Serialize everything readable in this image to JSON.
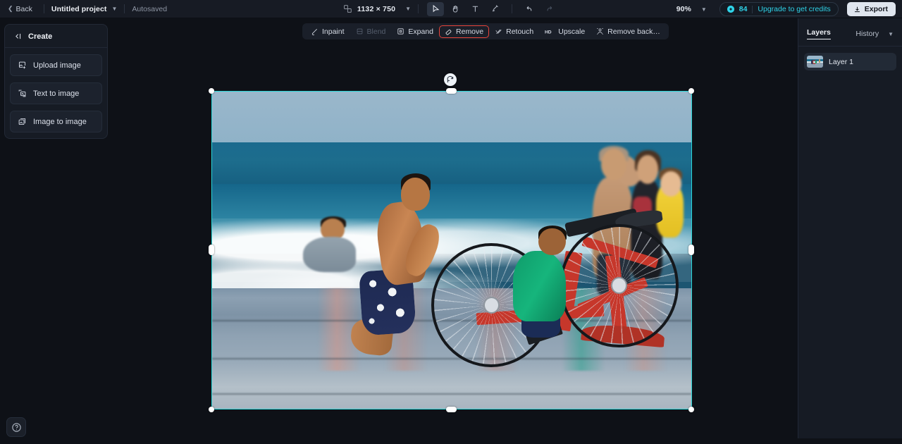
{
  "topbar": {
    "back_label": "Back",
    "project_name": "Untitled project",
    "autosaved_label": "Autosaved",
    "canvas_size": "1132 × 750",
    "zoom_level": "90%",
    "credits": "84",
    "upgrade_label": "Upgrade to get credits",
    "export_label": "Export",
    "tools": [
      {
        "name": "select-tool",
        "icon": "cursor-icon",
        "active": true
      },
      {
        "name": "hand-tool",
        "icon": "hand-icon",
        "active": false
      },
      {
        "name": "text-tool",
        "icon": "text-icon",
        "active": false
      },
      {
        "name": "brush-tool",
        "icon": "brush-icon",
        "active": false
      },
      {
        "name": "undo",
        "icon": "undo-icon",
        "active": false
      },
      {
        "name": "redo",
        "icon": "redo-icon",
        "active": false
      }
    ]
  },
  "edit_toolbar": {
    "items": [
      {
        "label": "Inpaint",
        "icon": "inpaint-icon",
        "state": "normal"
      },
      {
        "label": "Blend",
        "icon": "blend-icon",
        "state": "disabled"
      },
      {
        "label": "Expand",
        "icon": "expand-icon",
        "state": "normal"
      },
      {
        "label": "Remove",
        "icon": "eraser-icon",
        "state": "highlighted"
      },
      {
        "label": "Retouch",
        "icon": "retouch-icon",
        "state": "normal"
      },
      {
        "label": "Upscale",
        "icon": "hd-icon",
        "state": "normal"
      },
      {
        "label": "Remove back…",
        "icon": "remove-background-icon",
        "state": "normal"
      }
    ],
    "highlight_color": "#e8443a"
  },
  "left_panel": {
    "title": "Create",
    "collapse_icon": "collapse-panel-icon",
    "items": [
      {
        "label": "Upload image",
        "icon": "upload-image-icon"
      },
      {
        "label": "Text to image",
        "icon": "text-to-image-icon"
      },
      {
        "label": "Image to image",
        "icon": "image-to-image-icon"
      }
    ]
  },
  "right_panel": {
    "tab_layers": "Layers",
    "tab_history": "History",
    "layers": [
      {
        "name": "Layer 1"
      }
    ]
  },
  "canvas": {
    "selection_color": "#2ad7d9",
    "rotate_icon": "rotate-icon",
    "image_description": "Beach scene: a young man kneeling in ocean surf washing a red bicycle, a boy in a green shirt beside him, a swimmer and a family with a baby in the background"
  },
  "help": {
    "icon": "help-icon",
    "label": "?"
  },
  "theme": {
    "bg": "#0e1117",
    "panel": "#161b24",
    "accent": "#2fd3e8",
    "danger": "#e8443a"
  }
}
